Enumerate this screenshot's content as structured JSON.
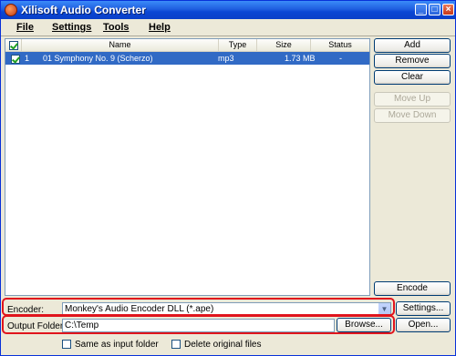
{
  "window": {
    "title": "Xilisoft Audio Converter"
  },
  "titlebar_buttons": {
    "minimize": "_",
    "maximize": "□",
    "close": "×"
  },
  "menu": [
    {
      "label": "File"
    },
    {
      "label": "Settings"
    },
    {
      "label": "Tools"
    },
    {
      "label": "Help"
    }
  ],
  "filelist": {
    "columns": [
      "Name",
      "Type",
      "Size",
      "Status"
    ],
    "rows": [
      {
        "checked": true,
        "index": "1",
        "name": "01 Symphony No. 9 (Scherzo)",
        "type": "mp3",
        "size": "1.73 MB",
        "status": "-"
      }
    ]
  },
  "buttons": {
    "add": "Add",
    "remove": "Remove",
    "clear": "Clear",
    "move_up": "Move Up",
    "move_down": "Move Down",
    "encode": "Encode",
    "settings": "Settings...",
    "browse": "Browse...",
    "open": "Open..."
  },
  "encoder": {
    "label": "Encoder:",
    "value": "Monkey's Audio Encoder DLL    (*.ape)"
  },
  "output": {
    "label": "Output Folder:",
    "value": "C:\\Temp"
  },
  "options": {
    "same_as_input": "Same as input folder",
    "delete_original": "Delete original files"
  },
  "colors": {
    "title_bar": "#0a46d4",
    "selection": "#316ac5",
    "highlight": "#e0141c"
  }
}
